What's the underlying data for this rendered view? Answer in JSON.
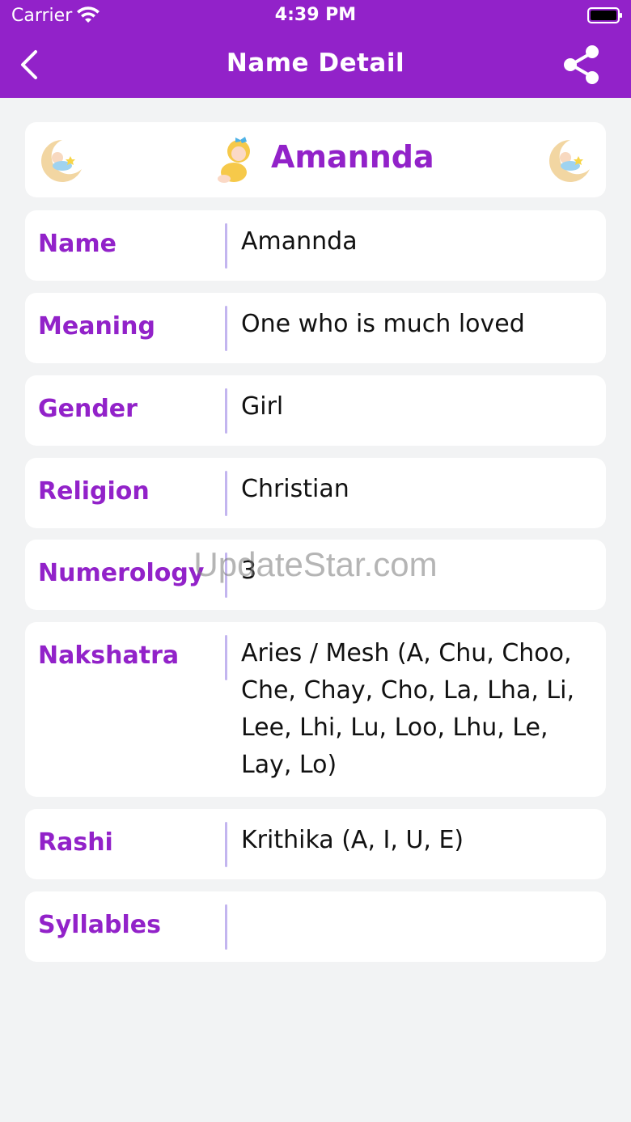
{
  "status_bar": {
    "carrier": "Carrier",
    "time": "4:39 PM",
    "icons": [
      "wifi-icon",
      "battery-icon"
    ]
  },
  "nav_bar": {
    "title": "Name Detail",
    "back_icon": "chevron-left-icon",
    "share_icon": "share-icon"
  },
  "header": {
    "name": "Amannda",
    "decorations": [
      "moon-baby-icon",
      "baby-girl-icon",
      "moon-baby-icon"
    ]
  },
  "details": [
    {
      "label": "Name",
      "value": "Amannda"
    },
    {
      "label": "Meaning",
      "value": "One who is much loved"
    },
    {
      "label": "Gender",
      "value": "Girl"
    },
    {
      "label": "Religion",
      "value": "Christian"
    },
    {
      "label": "Numerology",
      "value": "3"
    },
    {
      "label": "Nakshatra",
      "value": "Aries / Mesh (A, Chu, Choo, Che, Chay, Cho, La, Lha, Li, Lee, Lhi, Lu, Loo, Lhu, Le, Lay, Lo)"
    },
    {
      "label": "Rashi",
      "value": "Krithika (A, I, U, E)"
    },
    {
      "label": "Syllables",
      "value": ""
    }
  ],
  "watermark": "UpdateStar.com",
  "colors": {
    "primary": "#9222c9",
    "background": "#f2f3f4",
    "divider": "#c3b5ef"
  }
}
